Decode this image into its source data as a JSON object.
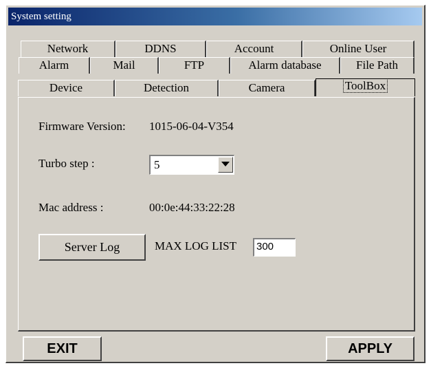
{
  "window": {
    "title": "System setting"
  },
  "tabs": {
    "row1": [
      "Network",
      "DDNS",
      "Account",
      "Online User"
    ],
    "row2": [
      "Alarm",
      "Mail",
      "FTP",
      "Alarm database",
      "File Path"
    ],
    "row3": [
      "Device",
      "Detection",
      "Camera",
      "ToolBox"
    ],
    "active": "ToolBox"
  },
  "toolbox": {
    "firmware_label": "Firmware Version:",
    "firmware_value": "1015-06-04-V354",
    "turbo_label": "Turbo step :",
    "turbo_value": "5",
    "mac_label": "Mac address :",
    "mac_value": "00:0e:44:33:22:28",
    "server_log_button": "Server Log",
    "max_log_label": "MAX LOG LIST",
    "max_log_value": "300"
  },
  "footer": {
    "exit_button": "EXIT",
    "apply_button": "APPLY"
  },
  "icons": {
    "dropdown": "chevron-down-icon"
  },
  "colors": {
    "titlebar_start": "#0a246a",
    "titlebar_end": "#a6caf0",
    "face": "#d4d0c8"
  }
}
